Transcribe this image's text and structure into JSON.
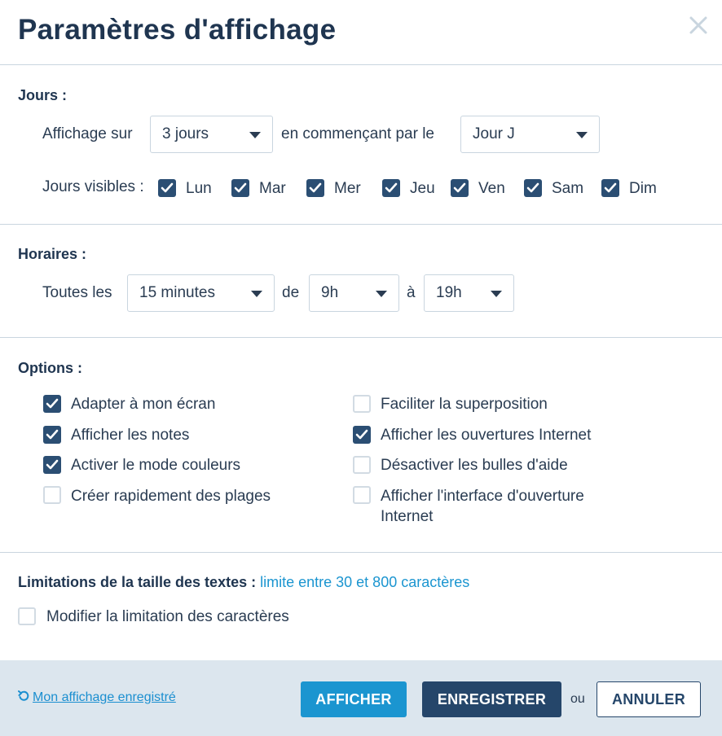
{
  "dialog": {
    "title": "Paramètres d'affichage"
  },
  "jours": {
    "title": "Jours :",
    "affichage_label": "Affichage sur",
    "affichage_value": "3 jours",
    "commencant_label": "en commençant par le",
    "commencant_value": "Jour J",
    "visibles_label": "Jours visibles :",
    "days": [
      {
        "label": "Lun",
        "checked": true
      },
      {
        "label": "Mar",
        "checked": true
      },
      {
        "label": "Mer",
        "checked": true
      },
      {
        "label": "Jeu",
        "checked": true
      },
      {
        "label": "Ven",
        "checked": true
      },
      {
        "label": "Sam",
        "checked": true
      },
      {
        "label": "Dim",
        "checked": true
      }
    ]
  },
  "horaires": {
    "title": "Horaires :",
    "toutes_label": "Toutes les",
    "interval_value": "15 minutes",
    "de_label": "de",
    "start_value": "9h",
    "a_label": "à",
    "end_value": "19h"
  },
  "options": {
    "title": "Options :",
    "items": [
      {
        "label": "Adapter à mon écran",
        "checked": true
      },
      {
        "label": "Afficher les notes",
        "checked": true
      },
      {
        "label": "Activer le mode couleurs",
        "checked": true
      },
      {
        "label": "Créer rapidement des plages",
        "checked": false
      },
      {
        "label": "Faciliter la superposition",
        "checked": false
      },
      {
        "label": "Afficher les ouvertures Internet",
        "checked": true
      },
      {
        "label": "Désactiver les bulles d'aide",
        "checked": false
      },
      {
        "label_line1": "Afficher l'interface d'ouverture",
        "label_line2": "Internet",
        "checked": false
      }
    ]
  },
  "limitations": {
    "title": "Limitations de la taille des textes :",
    "value": "limite entre 30 et 800 caractères",
    "modify_label": "Modifier la limitation des caractères",
    "modify_checked": false
  },
  "footer": {
    "saved_link": "Mon affichage enregistré",
    "afficher_label": "AFFICHER",
    "enregistrer_label": "ENREGISTRER",
    "ou_label": "ou",
    "annuler_label": "ANNULER"
  },
  "colors": {
    "primary": "#1b95d0",
    "dark": "#25466a",
    "checkbox_on": "#2b4e73",
    "link": "#1b8fd0",
    "footer_bg": "#dce6ee"
  },
  "icons": {
    "close": "close-icon",
    "check": "check-icon",
    "caret": "chevron-down-icon",
    "undo": "undo-icon"
  }
}
